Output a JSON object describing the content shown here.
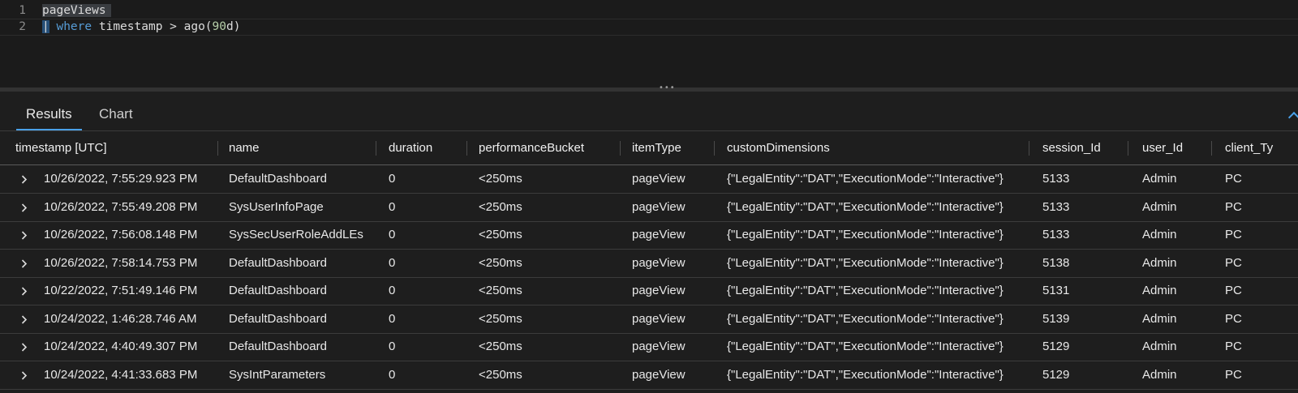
{
  "editor": {
    "lines": [
      {
        "number": "1",
        "tokens": {
          "a": "pageViews"
        }
      },
      {
        "number": "2",
        "tokens": {
          "pipe": "|",
          "kw": "where",
          "rest": " timestamp > ago(",
          "num": "90",
          "unit": "d",
          "close": ")"
        }
      }
    ]
  },
  "tabs": {
    "results": "Results",
    "chart": "Chart"
  },
  "columns": [
    "timestamp [UTC]",
    "name",
    "duration",
    "performanceBucket",
    "itemType",
    "customDimensions",
    "session_Id",
    "user_Id",
    "client_Ty"
  ],
  "rows": [
    [
      "10/26/2022, 7:55:29.923 PM",
      "DefaultDashboard",
      "0",
      "<250ms",
      "pageView",
      "{\"LegalEntity\":\"DAT\",\"ExecutionMode\":\"Interactive\"}",
      "5133",
      "Admin",
      "PC"
    ],
    [
      "10/26/2022, 7:55:49.208 PM",
      "SysUserInfoPage",
      "0",
      "<250ms",
      "pageView",
      "{\"LegalEntity\":\"DAT\",\"ExecutionMode\":\"Interactive\"}",
      "5133",
      "Admin",
      "PC"
    ],
    [
      "10/26/2022, 7:56:08.148 PM",
      "SysSecUserRoleAddLEs",
      "0",
      "<250ms",
      "pageView",
      "{\"LegalEntity\":\"DAT\",\"ExecutionMode\":\"Interactive\"}",
      "5133",
      "Admin",
      "PC"
    ],
    [
      "10/26/2022, 7:58:14.753 PM",
      "DefaultDashboard",
      "0",
      "<250ms",
      "pageView",
      "{\"LegalEntity\":\"DAT\",\"ExecutionMode\":\"Interactive\"}",
      "5138",
      "Admin",
      "PC"
    ],
    [
      "10/22/2022, 7:51:49.146 PM",
      "DefaultDashboard",
      "0",
      "<250ms",
      "pageView",
      "{\"LegalEntity\":\"DAT\",\"ExecutionMode\":\"Interactive\"}",
      "5131",
      "Admin",
      "PC"
    ],
    [
      "10/24/2022, 1:46:28.746 AM",
      "DefaultDashboard",
      "0",
      "<250ms",
      "pageView",
      "{\"LegalEntity\":\"DAT\",\"ExecutionMode\":\"Interactive\"}",
      "5139",
      "Admin",
      "PC"
    ],
    [
      "10/24/2022, 4:40:49.307 PM",
      "DefaultDashboard",
      "0",
      "<250ms",
      "pageView",
      "{\"LegalEntity\":\"DAT\",\"ExecutionMode\":\"Interactive\"}",
      "5129",
      "Admin",
      "PC"
    ],
    [
      "10/24/2022, 4:41:33.683 PM",
      "SysIntParameters",
      "0",
      "<250ms",
      "pageView",
      "{\"LegalEntity\":\"DAT\",\"ExecutionMode\":\"Interactive\"}",
      "5129",
      "Admin",
      "PC"
    ]
  ],
  "colors": {
    "accent": "#4aa0e8",
    "keyword": "#569cd6",
    "number": "#b5cea8"
  }
}
